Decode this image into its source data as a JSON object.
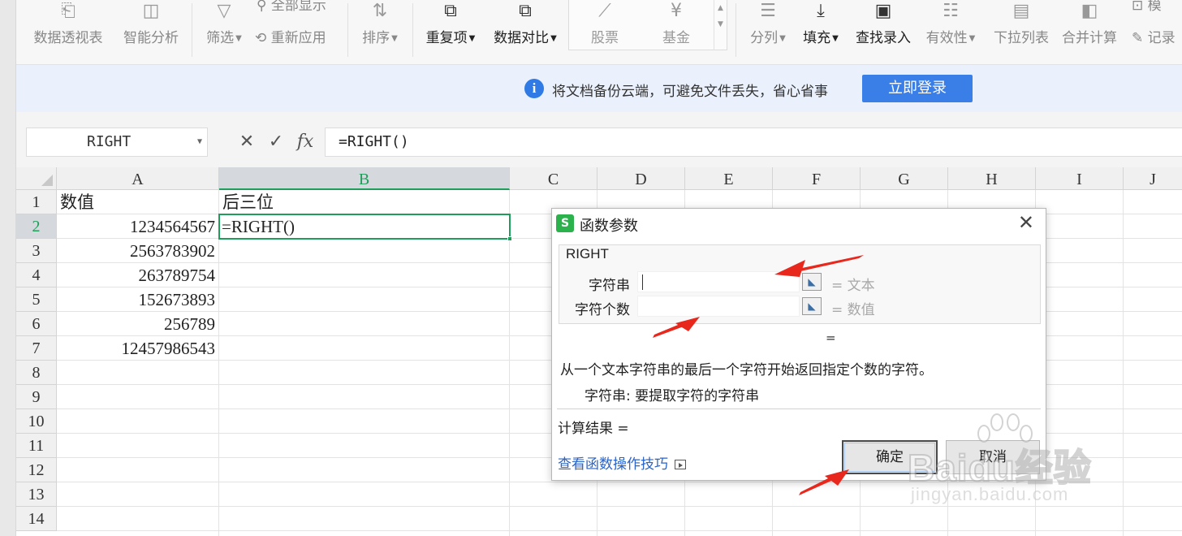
{
  "ribbon": {
    "buttons": [
      {
        "label": "数据透视表",
        "icon": "pivot-table-icon"
      },
      {
        "label": "智能分析",
        "icon": "smart-analysis-icon"
      },
      {
        "label": "筛选",
        "icon": "filter-icon"
      },
      {
        "label": "全部显示",
        "icon": "show-all-icon"
      },
      {
        "label": "重新应用",
        "icon": "reapply-icon"
      },
      {
        "label": "排序",
        "icon": "sort-icon"
      },
      {
        "label": "重复项",
        "icon": "duplicates-icon"
      },
      {
        "label": "数据对比",
        "icon": "data-compare-icon"
      },
      {
        "label": "股票",
        "icon": "stock-icon"
      },
      {
        "label": "基金",
        "icon": "fund-icon"
      },
      {
        "label": "分列",
        "icon": "split-columns-icon"
      },
      {
        "label": "填充",
        "icon": "fill-icon"
      },
      {
        "label": "查找录入",
        "icon": "find-entry-icon"
      },
      {
        "label": "有效性",
        "icon": "validity-icon"
      },
      {
        "label": "下拉列表",
        "icon": "dropdown-list-icon"
      },
      {
        "label": "合并计算",
        "icon": "consolidate-icon"
      },
      {
        "label": "记录",
        "icon": "record-icon"
      },
      {
        "label": "模",
        "icon": "template-icon"
      }
    ]
  },
  "banner": {
    "message": "将文档备份云端，可避免文件丢失，省心省事",
    "login_label": "立即登录",
    "info_glyph": "i"
  },
  "formula_bar": {
    "name_box": "RIGHT",
    "formula": "=RIGHT()"
  },
  "sheet": {
    "columns": [
      "A",
      "B",
      "C",
      "D",
      "E",
      "F",
      "G",
      "H",
      "I",
      "J"
    ],
    "rows": [
      "1",
      "2",
      "3",
      "4",
      "5",
      "6",
      "7",
      "8",
      "9",
      "10",
      "11",
      "12",
      "13",
      "14"
    ],
    "cells": {
      "A1": "数值",
      "B1": "后三位",
      "A2": "1234564567",
      "B2": "=RIGHT()",
      "A3": "2563783902",
      "A4": "263789754",
      "A5": "152673893",
      "A6": "256789",
      "A7": "12457986543"
    },
    "active_cell": "B2"
  },
  "dialog": {
    "title": "函数参数",
    "app_glyph": "S",
    "close_glyph": "✕",
    "function_name": "RIGHT",
    "args": [
      {
        "label": "字符串",
        "result": "= 文本"
      },
      {
        "label": "字符个数",
        "result": "= 数值"
      }
    ],
    "equals": "=",
    "description": "从一个文本字符串的最后一个字符开始返回指定个数的字符。",
    "param_help": "字符串:  要提取字符的字符串",
    "calc_result": "计算结果 =",
    "help_link": "查看函数操作技巧",
    "ok_label": "确定",
    "cancel_label": "取消"
  },
  "watermark": {
    "brand": "Baidu经验",
    "domain": "jingyan.baidu.com"
  },
  "colors": {
    "accent_green": "#1e9e5a",
    "login_blue": "#3a7fe8",
    "banner_bg": "#eaf1fc",
    "arrow_red": "#e8271d",
    "link_blue": "#2a64c8"
  }
}
